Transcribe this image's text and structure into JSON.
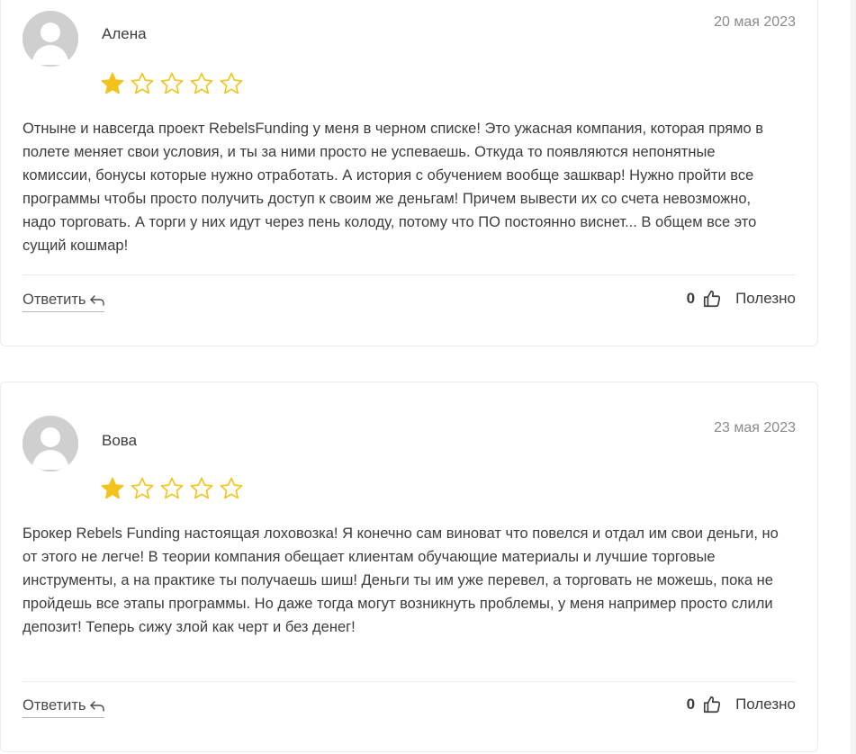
{
  "reviews": [
    {
      "author": "Алена",
      "date": "20 мая 2023",
      "rating": 1,
      "max_rating": 5,
      "text": "Отныне и навсегда проект RebelsFunding у меня в черном списке! Это ужасная компания, которая прямо в полете меняет свои условия, и ты за ними просто не успеваешь. Откуда то появляются непонятные комиссии, бонусы которые нужно отработать. А история с обучением вообще зашквар! Нужно пройти все программы чтобы просто получить доступ к своим же деньгам! Причем вывести их со счета невозможно, надо торговать. А торги у них идут через пень колоду, потому что ПО постоянно виснет... В общем все это сущий кошмар!",
      "reply_label": "Ответить",
      "helpful_count": "0",
      "helpful_label": "Полезно"
    },
    {
      "author": "Вова",
      "date": "23 мая 2023",
      "rating": 1,
      "max_rating": 5,
      "text": "Брокер Rebels Funding настоящая лоховозка! Я конечно сам виноват что повелся и отдал им свои деньги, но от этого не легче! В теории компания обещает клиентам обучающие материалы и лучшие торговые инструменты, а на практике ты получаешь шиш! Деньги ты им уже перевел, а торговать не можешь, пока не пройдешь все этапы программы. Но даже тогда могут возникнуть проблемы, у меня например просто слили депозит! Теперь сижу злой как черт и без денег!",
      "reply_label": "Ответить",
      "helpful_count": "0",
      "helpful_label": "Полезно"
    }
  ],
  "icons": {
    "avatar": "user-avatar-icon",
    "star_filled": "star-filled-icon",
    "star_empty": "star-empty-icon",
    "reply": "reply-arrow-icon",
    "thumb": "thumbs-up-icon"
  },
  "colors": {
    "star": "#f2c31a",
    "avatar_bg": "#cfcfcf",
    "date": "#8a8a8a",
    "text": "#3c3c3c"
  }
}
